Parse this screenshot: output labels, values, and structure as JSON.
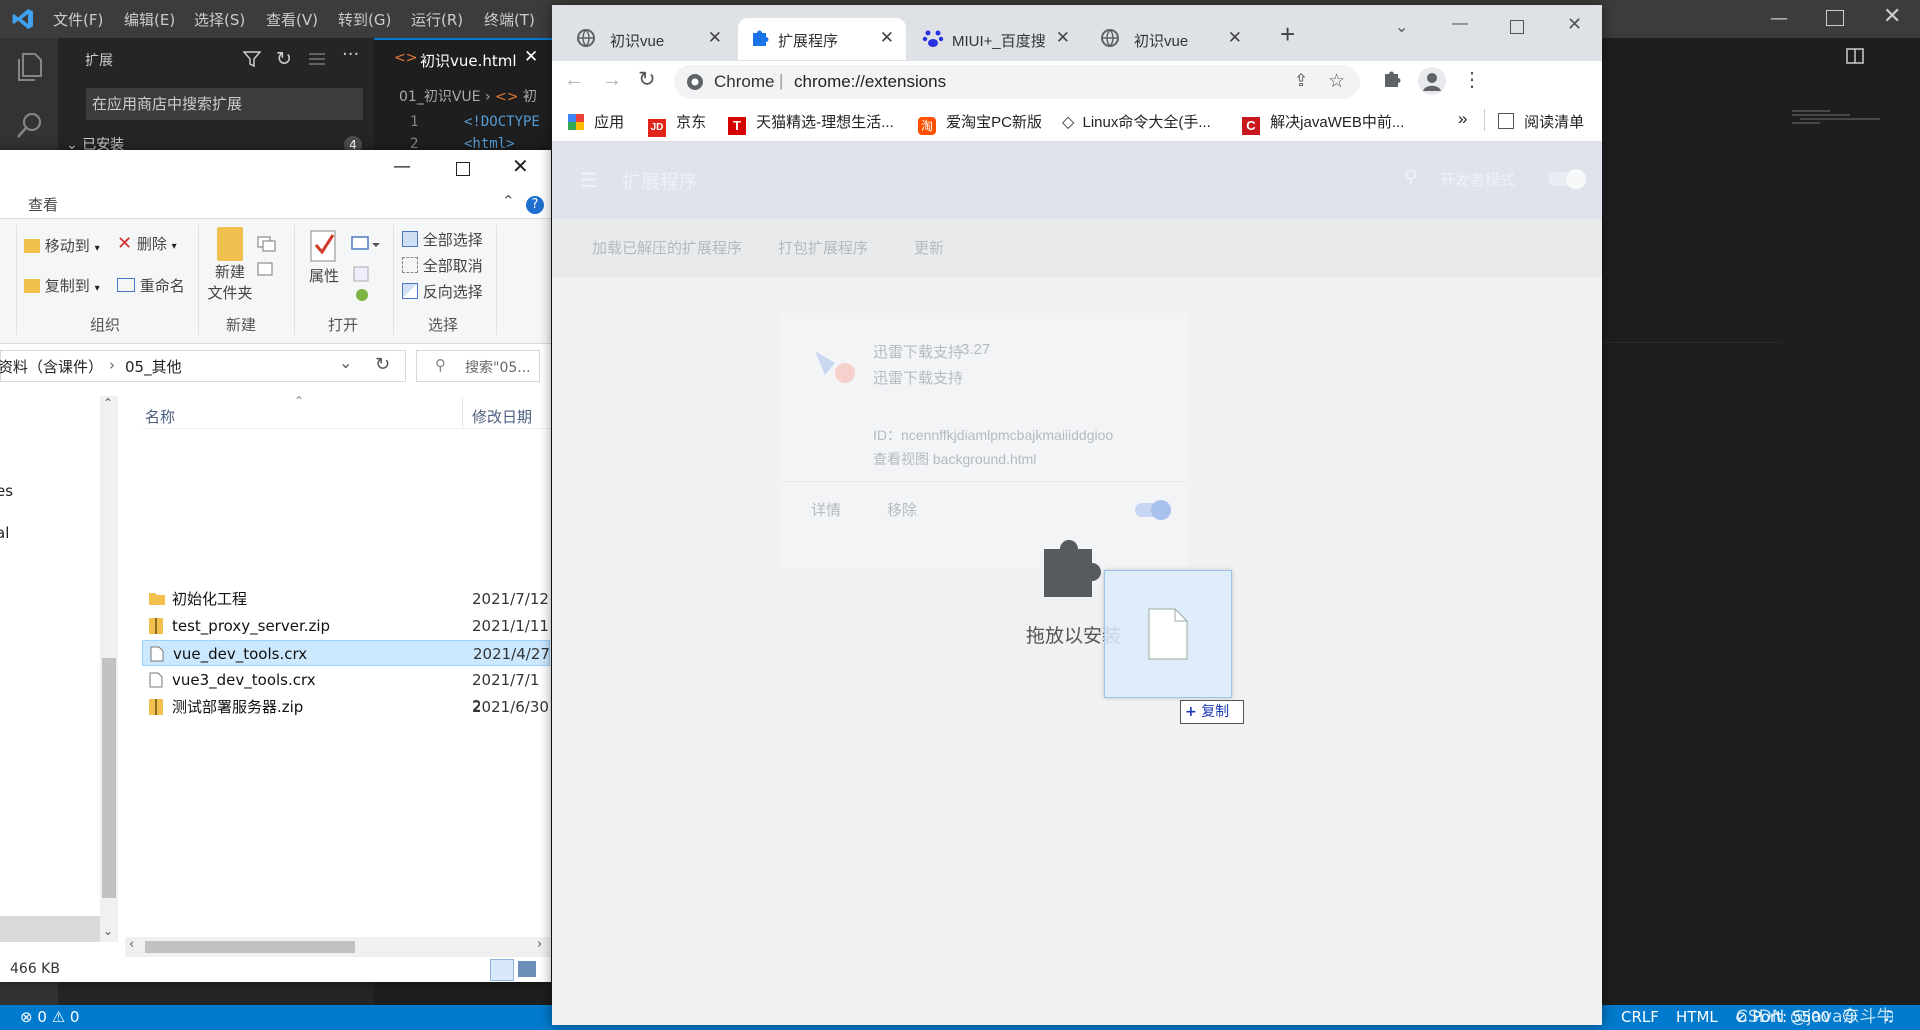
{
  "vscode": {
    "menu": [
      "文件(F)",
      "编辑(E)",
      "选择(S)",
      "查看(V)",
      "转到(G)",
      "运行(R)",
      "终端(T)"
    ],
    "sidebar_title": "扩展",
    "search_placeholder": "在应用商店中搜索扩展",
    "installed_label": "已安装",
    "installed_count": "4",
    "tab_label": "初识vue.html",
    "breadcrumb_folder": "01_初识VUE",
    "breadcrumb_file": "初",
    "lines": [
      {
        "num": "1",
        "code": "<!DOCTYPE"
      },
      {
        "num": "2",
        "code": "<html>"
      }
    ],
    "status": {
      "errors": "0",
      "warnings": "0",
      "eol": "CRLF",
      "language": "HTML",
      "port": "Port: 5500"
    },
    "watermark": "CSDN @java东斗牛"
  },
  "explorer": {
    "ribbon_tab": "查看",
    "move_to": "移动到",
    "copy_to": "复制到",
    "delete": "删除",
    "rename": "重命名",
    "new_folder_line1": "新建",
    "new_folder_line2": "文件夹",
    "properties": "属性",
    "select_all": "全部选择",
    "select_none": "全部取消",
    "invert_selection": "反向选择",
    "groups": [
      "组织",
      "新建",
      "打开",
      "选择"
    ],
    "path_parent": "资料（含课件）",
    "path_current": "05_其他",
    "search_placeholder": "搜索\"05...",
    "col_name": "名称",
    "col_date": "修改日期",
    "files": [
      {
        "name": "初始化工程",
        "date": "2021/7/12",
        "type": "folder"
      },
      {
        "name": "test_proxy_server.zip",
        "date": "2021/1/11",
        "type": "zip"
      },
      {
        "name": "vue_dev_tools.crx",
        "date": "2021/4/27",
        "type": "file"
      },
      {
        "name": "vue3_dev_tools.crx",
        "date": "2021/7/1 2",
        "type": "file"
      },
      {
        "name": "测试部署服务器.zip",
        "date": "2021/6/30",
        "type": "zip"
      }
    ],
    "selected_index": 2,
    "left_nav_fragments": [
      "es",
      "al"
    ],
    "status_size": "466 KB"
  },
  "chrome": {
    "tabs": [
      {
        "label": "初识vue",
        "icon": "globe-icon"
      },
      {
        "label": "扩展程序",
        "icon": "puzzle-icon"
      },
      {
        "label": "MIUI+_百度搜",
        "icon": "baidu-paw-icon"
      },
      {
        "label": "初识vue",
        "icon": "globe-icon"
      }
    ],
    "active_tab": 1,
    "address_site": "Chrome",
    "address_url": "chrome://extensions",
    "bookmarks": [
      "应用",
      "京东",
      "天猫精选-理想生活...",
      "爱淘宝PC新版",
      "Linux命令大全(手...",
      "解决javaWEB中前..."
    ],
    "more_bookmarks": "»",
    "reading_list": "阅读清单",
    "ext_page": {
      "header_title": "扩展程序",
      "dev_mode": "开发者模式",
      "load_unpacked": "加载已解压的扩展程序",
      "pack_extension": "打包扩展程序",
      "update": "更新",
      "card_name": "迅雷下载支持",
      "card_version": "3.27",
      "card_desc": "迅雷下载支持",
      "card_id": "ID：ncennffkjdiamlpmcbajkmaiiiddgioo",
      "card_view": "查看视图 background.html",
      "details": "详情",
      "remove": "移除",
      "drop_to_install": "拖放以安装",
      "copy_badge": "复制"
    }
  }
}
